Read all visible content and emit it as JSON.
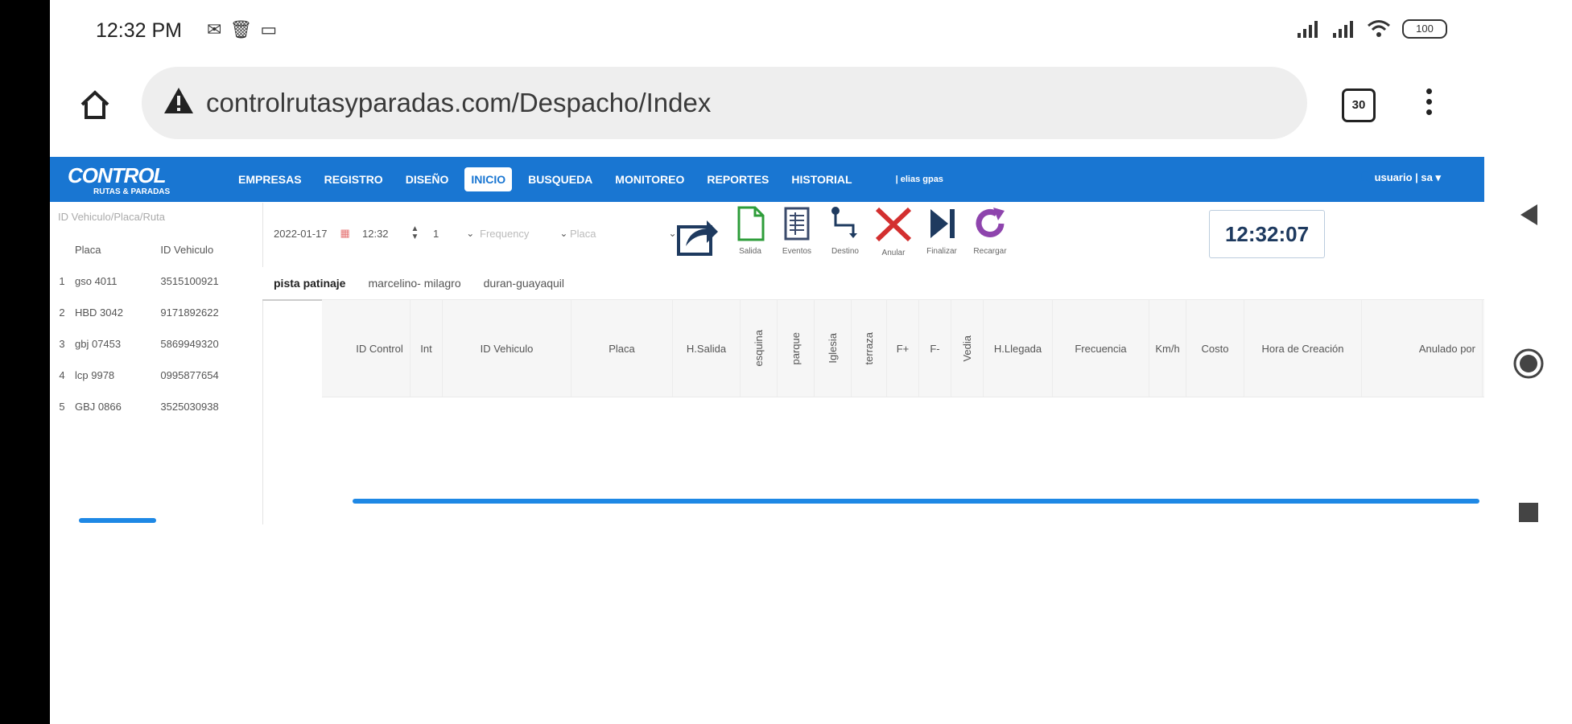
{
  "status_bar": {
    "time": "12:32 PM",
    "battery": "100"
  },
  "browser": {
    "url": "controlrutasyparadas.com/Despacho/Index",
    "tab_count": "30"
  },
  "app": {
    "logo_text": "CONTROL",
    "logo_subtext": "RUTAS & PARADAS",
    "menu": [
      "EMPRESAS",
      "REGISTRO",
      "DISEÑO",
      "INICIO",
      "BUSQUEDA",
      "MONITOREO",
      "REPORTES",
      "HISTORIAL"
    ],
    "active_menu": "INICIO",
    "menu_extra": "| elias gpas",
    "user_label": "usuario | sa"
  },
  "left_panel": {
    "filter_placeholder": "ID Vehiculo/Placa/Ruta",
    "columns": [
      "Placa",
      "ID Vehiculo"
    ],
    "rows": [
      {
        "idx": "1",
        "placa": "gso 4011",
        "id": "3515100921"
      },
      {
        "idx": "2",
        "placa": "HBD 3042",
        "id": "9171892622"
      },
      {
        "idx": "3",
        "placa": "gbj 07453",
        "id": "5869949320"
      },
      {
        "idx": "4",
        "placa": "lcp 9978",
        "id": "0995877654"
      },
      {
        "idx": "5",
        "placa": "GBJ 0866",
        "id": "3525030938"
      }
    ]
  },
  "toolbar": {
    "date": "2022-01-17",
    "time": "12:32",
    "count": "1",
    "frequency_placeholder": "Frequency",
    "placa_placeholder": "Placa",
    "tools": [
      "Salida",
      "Eventos",
      "Destino",
      "Anular",
      "Finalizar",
      "Recargar"
    ],
    "clock": "12:32:07"
  },
  "route_tabs": [
    "pista patinaje",
    "marcelino- milagro",
    "duran-guayaquil"
  ],
  "grid": {
    "columns": [
      "ID Control",
      "Int",
      "ID Vehiculo",
      "Placa",
      "H.Salida",
      "esquina",
      "parque",
      "Iglesia",
      "terraza",
      "F+",
      "F-",
      "Vedia",
      "H.Llegada",
      "Frecuencia",
      "Km/h",
      "Costo",
      "Hora de Creación",
      "Anulado por"
    ]
  },
  "colors": {
    "nav_blue": "#1976d2",
    "scroll_blue": "#1e88e5"
  }
}
